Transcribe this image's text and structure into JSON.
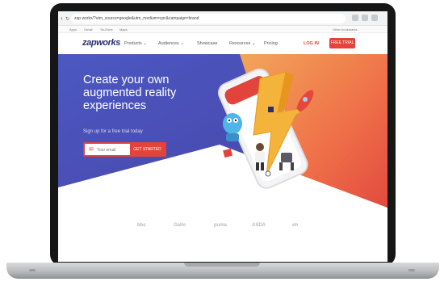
{
  "browser": {
    "back_icon": "back-arrow-icon",
    "reload_icon": "reload-icon",
    "url": "zap.works/?utm_source=google&utm_medium=cpc&campaign=brand",
    "bookmarks": [
      "Apps",
      "Gmail",
      "YouTube",
      "Maps",
      "Other bookmarks"
    ]
  },
  "site": {
    "logo": "zapworks",
    "nav": [
      "Products",
      "Audiences",
      "Showcase",
      "Resources",
      "Pricing"
    ],
    "login": "LOG IN",
    "trial_button": "FREE TRIAL"
  },
  "hero": {
    "headline": "Create your own augmented reality experiences",
    "subheading": "Sign up for a free trial today",
    "email_placeholder": "Your email",
    "cta_label": "GET STARTED"
  },
  "partners": [
    "bbc",
    "Gallo",
    "puma",
    "ASDA",
    "eh"
  ],
  "colors": {
    "accent": "#e2433a",
    "hero_blue": "#4a4fb3",
    "hero_orange": "#f0784a",
    "laptop_frame": "#161616"
  }
}
